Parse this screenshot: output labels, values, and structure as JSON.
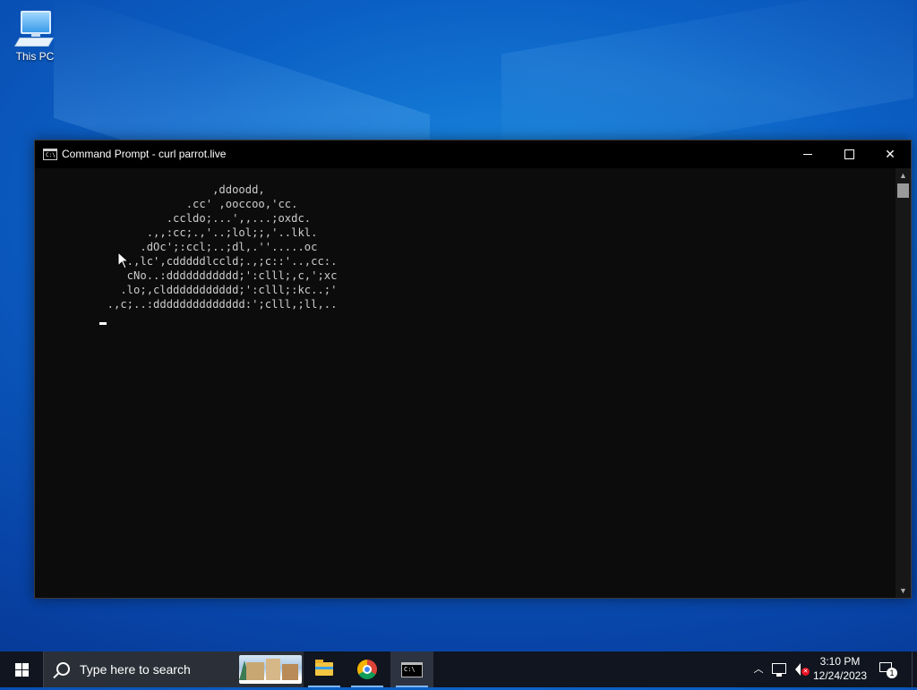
{
  "desktop": {
    "icons": [
      {
        "label": "This PC",
        "icon": "this-pc-icon"
      }
    ]
  },
  "window": {
    "title": "Command Prompt - curl  parrot.live",
    "icon": "cmd-icon",
    "controls": {
      "minimize": "minimize-icon",
      "maximize": "maximize-icon",
      "close": "close-icon"
    },
    "console_lines": [
      "                  ,ddoodd,",
      "              .cc' ,ooccoo,'cc.",
      "           .ccldo;...',,...;oxdc.",
      "        .,,:cc;.,'..;lol;;,'..lkl.",
      "       .dOc';:ccl;..;dl,.''.....oc",
      "     .,lc',cdddddlccld;.,;c::'..,cc:.",
      "     cNo..:ddddddddddd;':clll;,c,';xc",
      "    .lo;,clddddddddddd;':clll;:kc..;'",
      "  .,c;..:dddddddddddddd:';clll,;ll,.."
    ]
  },
  "taskbar": {
    "search_placeholder": "Type here to search",
    "apps": [
      {
        "name": "file-explorer",
        "icon": "folder-icon"
      },
      {
        "name": "chrome",
        "icon": "chrome-icon"
      },
      {
        "name": "command-prompt",
        "icon": "cmd-icon"
      }
    ],
    "clock": {
      "time": "3:10 PM",
      "date": "12/24/2023"
    },
    "notification_count": "1"
  },
  "colors": {
    "console_bg": "#0c0c0c",
    "console_text": "#cccccc",
    "taskbar_bg": "#10151f",
    "desktop_blue": "#0b5fc4"
  }
}
